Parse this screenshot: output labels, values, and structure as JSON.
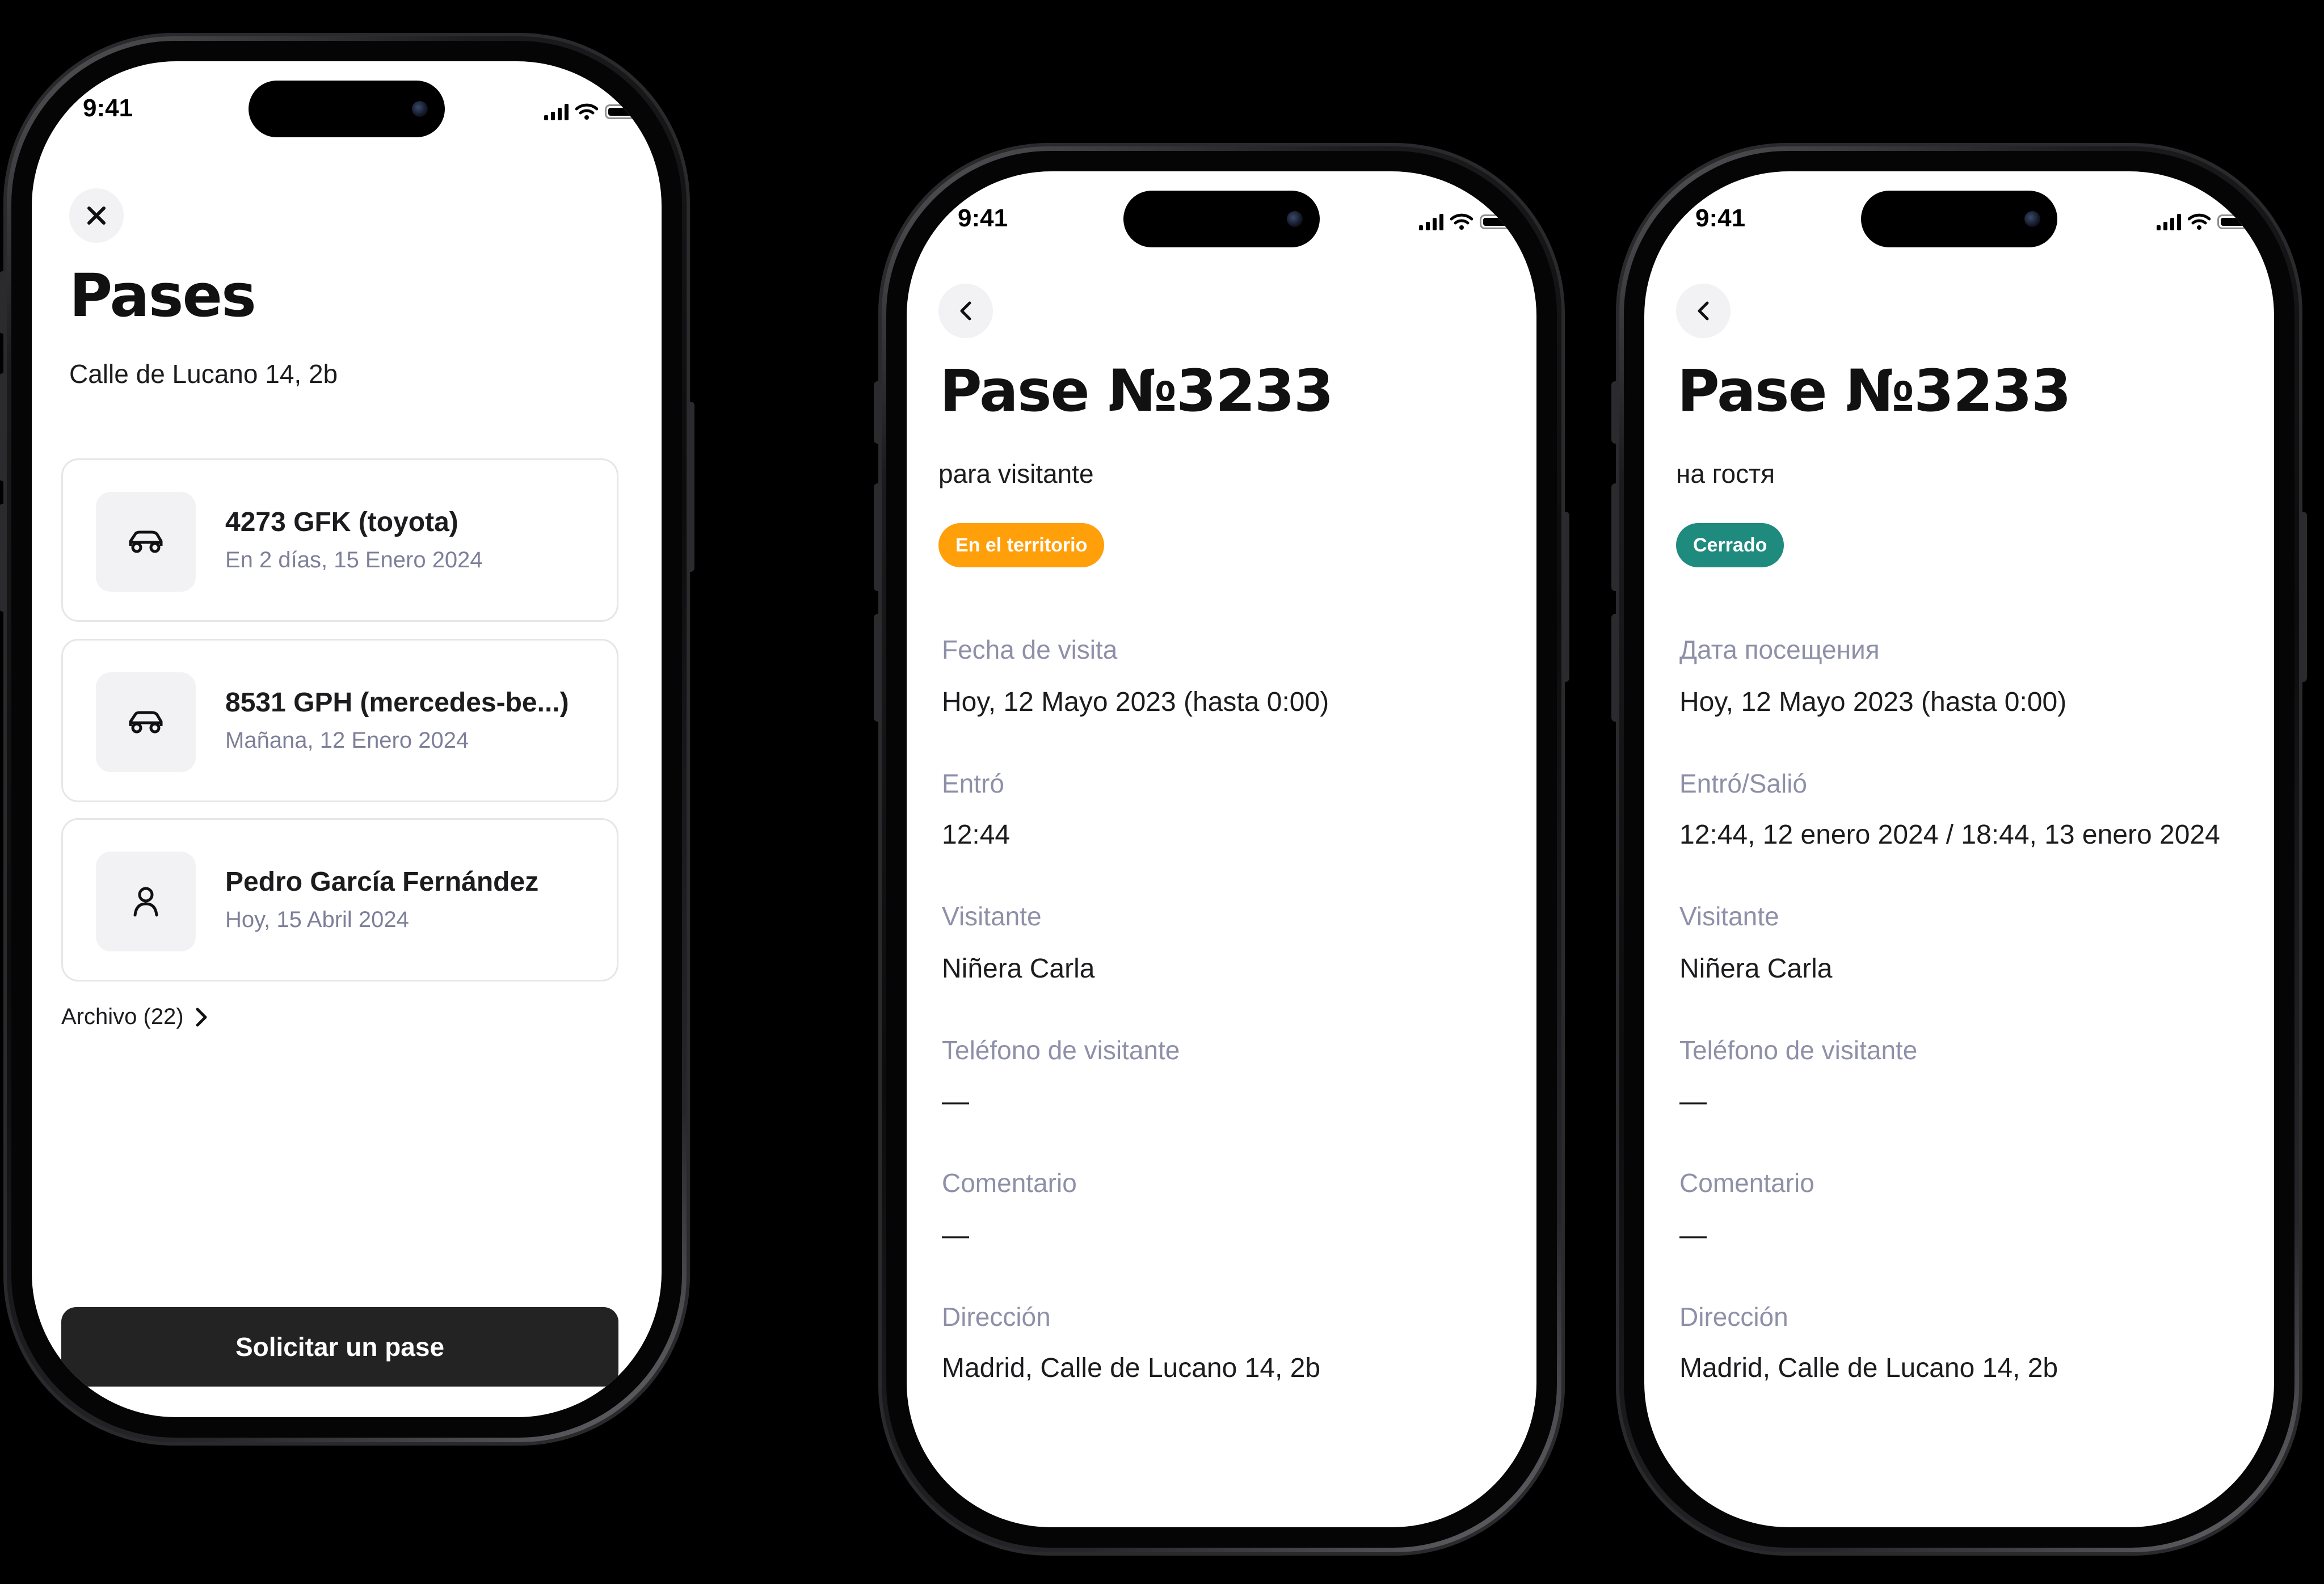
{
  "status_time": "9:41",
  "list_screen": {
    "close_icon": "close-icon",
    "title": "Pases",
    "address": "Calle de Lucano 14, 2b",
    "passes": [
      {
        "icon": "car-icon",
        "title": "4273 GFK (toyota)",
        "subtitle": "En 2 días, 15 Enero 2024"
      },
      {
        "icon": "car-icon",
        "title": "8531 GPH (mercedes-be...)",
        "subtitle": "Mañana, 12 Enero 2024"
      },
      {
        "icon": "person-icon",
        "title": "Pedro García Fernández",
        "subtitle": "Hoy, 15 Abril 2024"
      }
    ],
    "archive_label": "Archivo (22)",
    "request_button": "Solicitar un pase"
  },
  "detail_es": {
    "title": "Pase №3233",
    "subtitle": "para visitante",
    "badge": "En el territorio",
    "badge_color": "#ff9f0a",
    "fields": [
      {
        "label": "Fecha de visita",
        "value": "Hoy, 12 Mayo 2023 (hasta 0:00)"
      },
      {
        "label": "Entró",
        "value": "12:44"
      },
      {
        "label": "Visitante",
        "value": "Niñera Carla"
      },
      {
        "label": "Teléfono de visitante",
        "value": "—"
      },
      {
        "label": "Comentario",
        "value": "—"
      },
      {
        "label": "Dirección",
        "value": "Madrid, Calle de Lucano 14, 2b"
      }
    ]
  },
  "detail_ru": {
    "title": "Pase №3233",
    "subtitle": "на гостя",
    "badge": "Cerrado",
    "badge_color": "#1f8a7e",
    "fields": [
      {
        "label": "Дата посещения",
        "value": "Hoy, 12 Mayo 2023 (hasta 0:00)"
      },
      {
        "label": "Entró/Salió",
        "value": "12:44, 12 enero 2024 / 18:44, 13 enero 2024"
      },
      {
        "label": "Visitante",
        "value": "Niñera Carla"
      },
      {
        "label": "Teléfono de visitante",
        "value": "—"
      },
      {
        "label": "Comentario",
        "value": "—"
      },
      {
        "label": "Dirección",
        "value": "Madrid, Calle de Lucano 14, 2b"
      }
    ]
  }
}
